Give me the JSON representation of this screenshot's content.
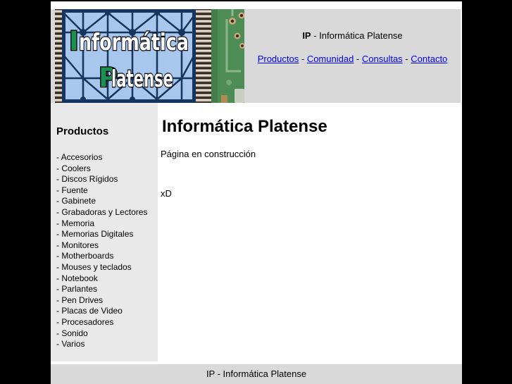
{
  "header": {
    "title_bold": "IP",
    "title_rest": " - Informática Platense",
    "nav": [
      "Productos",
      "Comunidad",
      "Consultas",
      "Contacto"
    ],
    "nav_separator": " - "
  },
  "logo": {
    "line1_initial": "I",
    "line1_rest": "nformática",
    "line2_initial": "P",
    "line2_rest": "latense"
  },
  "sidebar": {
    "heading": "Productos",
    "item_prefix": "- ",
    "items": [
      "Accesorios",
      "Coolers",
      "Discos Rígidos",
      "Fuente",
      "Gabinete",
      "Grabadoras y Lectores",
      "Memoria",
      "Memorias Digitales",
      "Monitores",
      "Motherboards",
      "Mouses y teclados",
      "Notebook",
      "Parlantes",
      "Pen Drives",
      "Placas de Video",
      "Procesadores",
      "Sonido",
      "Varios"
    ]
  },
  "main": {
    "title": "Informática Platense",
    "construction_text": "Página en construcción",
    "emoticon": "xD"
  },
  "footer": {
    "text": "IP - Informática Platense"
  },
  "colors": {
    "body_bg": "#000000",
    "page_bg": "#ffffff",
    "header_bg": "#d9d9d9",
    "sidebar_bg": "#e9e9e9",
    "footer_bg": "#d9d9d9",
    "link": "#0000ee",
    "logo_initial_green": "#1e8f52",
    "logo_panel_blue": "#a9c6ed",
    "logo_grid_navy": "#16355e",
    "logo_pcb_green": "#4e8c55"
  }
}
